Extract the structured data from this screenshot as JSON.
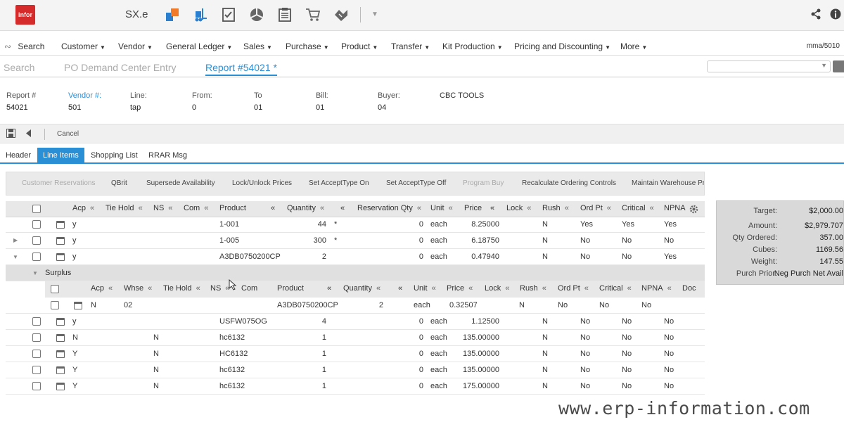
{
  "app": {
    "logo": "infor",
    "name": "SX.e"
  },
  "toolbar_icons": [
    "blocks-icon",
    "forklift-icon",
    "checklist-icon",
    "pie-chart-icon",
    "clipboard-icon",
    "cart-icon",
    "handshake-icon"
  ],
  "menu": {
    "search": "Search",
    "items": [
      "Customer",
      "Vendor",
      "General Ledger",
      "Sales",
      "Purchase",
      "Product",
      "Transfer",
      "Kit Production",
      "Pricing and Discounting",
      "More"
    ],
    "user": "mma/5010"
  },
  "nav_tabs": [
    "Search",
    "PO Demand Center Entry",
    "Report #54021 *"
  ],
  "header_fields": [
    {
      "label": "Report #",
      "value": "54021"
    },
    {
      "label": "Vendor #:",
      "value": "501"
    },
    {
      "label": "Line:",
      "value": "tap"
    },
    {
      "label": "From:",
      "value": "0"
    },
    {
      "label": "To",
      "value": "01"
    },
    {
      "label": "Bill:",
      "value": "01"
    },
    {
      "label": "Buyer:",
      "value": "04"
    },
    {
      "label": "CBC TOOLS",
      "value": ""
    }
  ],
  "actions": {
    "cancel": "Cancel"
  },
  "sub_tabs": [
    "Header",
    "Line Items",
    "Shopping List",
    "RRAR Msg"
  ],
  "function_buttons": [
    "Customer Reservations",
    "QBrit",
    "Supersede Availability",
    "Lock/Unlock Prices",
    "Set AcceptType On",
    "Set AcceptType Off",
    "Program Buy",
    "Recalculate Ordering Controls",
    "Maintain Warehouse Pro"
  ],
  "grid": {
    "columns": [
      "Acp",
      "Tie Hold",
      "NS",
      "Com",
      "Product",
      "Quantity",
      "Reservation Qty",
      "Unit",
      "Price",
      "Lock",
      "Rush",
      "Ord Pt",
      "Critical",
      "NPNA"
    ],
    "rows_top": [
      {
        "acp": "y",
        "ns": "",
        "product": "1-001",
        "qty": "44",
        "star": "*",
        "res": "0",
        "unit": "each",
        "price": "8.25000",
        "rush": "N",
        "ordpt": "Yes",
        "critical": "Yes",
        "npna": "Yes"
      },
      {
        "acp": "y",
        "ns": "",
        "product": "1-005",
        "qty": "300",
        "star": "*",
        "res": "0",
        "unit": "each",
        "price": "6.18750",
        "rush": "N",
        "ordpt": "No",
        "critical": "No",
        "npna": "No"
      },
      {
        "acp": "y",
        "ns": "",
        "product": "A3DB0750200CP",
        "qty": "2",
        "star": "",
        "res": "0",
        "unit": "each",
        "price": "0.47940",
        "rush": "N",
        "ordpt": "No",
        "critical": "No",
        "npna": "Yes"
      }
    ],
    "surplus": {
      "label": "Surplus",
      "columns": [
        "Acp",
        "Whse",
        "Tie Hold",
        "NS",
        "Com",
        "Product",
        "Quantity",
        "Unit",
        "Price",
        "Lock",
        "Rush",
        "Ord Pt",
        "Critical",
        "NPNA",
        "Doc"
      ],
      "row": {
        "acp": "N",
        "whse": "02",
        "product": "A3DB0750200CP",
        "qty": "2",
        "unit": "each",
        "price": "0.32507",
        "rush": "N",
        "ordpt": "No",
        "critical": "No",
        "npna": "No"
      }
    },
    "rows_bottom": [
      {
        "acp": "y",
        "ns": "",
        "product": "USFW075OG",
        "qty": "4",
        "star": "",
        "res": "0",
        "unit": "each",
        "price": "1.12500",
        "rush": "N",
        "ordpt": "No",
        "critical": "No",
        "npna": "No"
      },
      {
        "acp": "N",
        "ns": "N",
        "product": "hc6132",
        "qty": "1",
        "star": "",
        "res": "0",
        "unit": "each",
        "price": "135.00000",
        "rush": "N",
        "ordpt": "No",
        "critical": "No",
        "npna": "No"
      },
      {
        "acp": "Y",
        "ns": "N",
        "product": "HC6132",
        "qty": "1",
        "star": "",
        "res": "0",
        "unit": "each",
        "price": "135.00000",
        "rush": "N",
        "ordpt": "No",
        "critical": "No",
        "npna": "No"
      },
      {
        "acp": "Y",
        "ns": "N",
        "product": "hc6132",
        "qty": "1",
        "star": "",
        "res": "0",
        "unit": "each",
        "price": "135.00000",
        "rush": "N",
        "ordpt": "No",
        "critical": "No",
        "npna": "No"
      },
      {
        "acp": "Y",
        "ns": "N",
        "product": "hc6132",
        "qty": "1",
        "star": "",
        "res": "0",
        "unit": "each",
        "price": "175.00000",
        "rush": "N",
        "ordpt": "No",
        "critical": "No",
        "npna": "No"
      }
    ]
  },
  "summary": [
    {
      "label": "Target:",
      "value": "$2,000.00"
    },
    {
      "label": "Amount:",
      "value": "$2,979.707"
    },
    {
      "label": "Qty Ordered:",
      "value": "357.00"
    },
    {
      "label": "Cubes:",
      "value": "1169.56"
    },
    {
      "label": "Weight:",
      "value": "147.55"
    },
    {
      "label": "Purch Prior:",
      "value": "Neg Purch Net Avail"
    }
  ],
  "watermark": "www.erp-information.com",
  "colors": {
    "accent": "#2b8fd6",
    "logo": "#d62b2b"
  }
}
